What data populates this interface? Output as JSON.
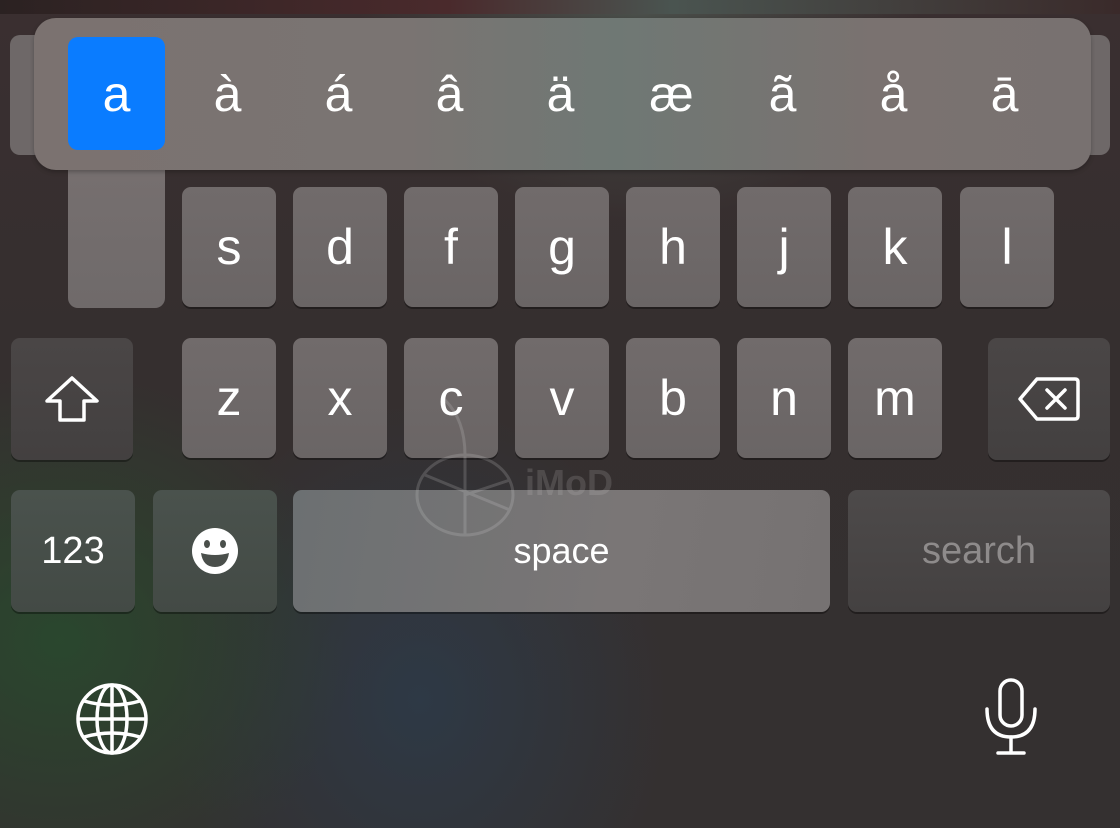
{
  "keyboard": {
    "accent_popup": {
      "base_key": "a",
      "selected_index": 0,
      "options": [
        "a",
        "à",
        "á",
        "â",
        "ä",
        "æ",
        "ã",
        "å",
        "ā"
      ]
    },
    "row2": [
      "s",
      "d",
      "f",
      "g",
      "h",
      "j",
      "k",
      "l"
    ],
    "row3": [
      "z",
      "x",
      "c",
      "v",
      "b",
      "n",
      "m"
    ],
    "shift_icon": "shift-arrow-icon",
    "delete_icon": "backspace-icon",
    "numbers_label": "123",
    "emoji_icon": "emoji-smile-icon",
    "space_label": "space",
    "search_label": "search",
    "globe_icon": "globe-icon",
    "mic_icon": "microphone-icon",
    "accent_color": "#0A7CFF"
  },
  "watermark": {
    "text": "iMoD"
  }
}
